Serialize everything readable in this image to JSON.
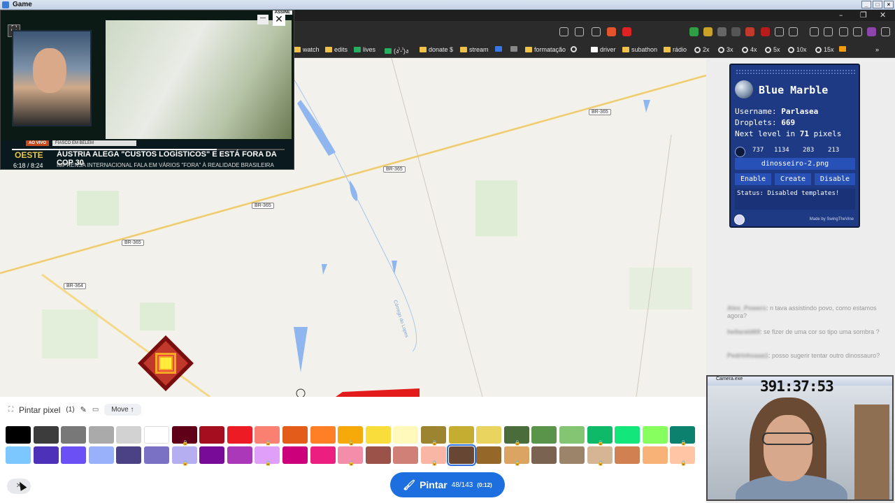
{
  "window": {
    "title": "Game"
  },
  "bookmarks": [
    "watch",
    "edits",
    "lives",
    "(ง'̀-'́)ง",
    "donate $",
    "stream",
    "formatação",
    "driver",
    "subathon",
    "rádio",
    "2x",
    "3x",
    "4x",
    "5x",
    "10x",
    "15x"
  ],
  "map": {
    "road_labels": [
      "BR-365",
      "BR-365",
      "BR-365",
      "BR-365",
      "BR-364"
    ],
    "stream_label": "Córrego do Lopes"
  },
  "pip": {
    "live_badge": "AO VIVO",
    "subtitle": "FIASCO EM BELÉM",
    "headline": "ÁUSTRIA ALEGA \"CUSTOS LOGÍSTICOS\" E ESTÁ FORA DA COP 30",
    "subline": "IMPRENSA INTERNACIONAL FALA EM VÁRIOS \"FORA\" À REALIDADE BRASILEIRA",
    "time": "6:18 / 8:24",
    "channel": "OESTE",
    "assine": "ASSINE",
    "progress": 0.75
  },
  "blue_marble": {
    "title": "Blue Marble",
    "username_label": "Username:",
    "username": "Parlasea",
    "droplets_label": "Droplets:",
    "droplets": "669",
    "next_level_prefix": "Next level in",
    "next_level_value": "71",
    "next_level_suffix": "pixels",
    "coords": [
      "737",
      "1134",
      "283",
      "213"
    ],
    "file": "dinosseiro-2.png",
    "buttons": {
      "enable": "Enable",
      "create": "Create",
      "disable": "Disable"
    },
    "status": "Status: Disabled templates!",
    "made_by": "Made by SwingTheVine"
  },
  "chat": [
    {
      "user": "Alex_Powers",
      "text": ": n tava assistindo povo, como estamos agora?"
    },
    {
      "user": "hellarald69",
      "text": ": se fizer de uma cor so tipo uma sombra ?"
    },
    {
      "user": "Pedrinhoaaa1",
      "text": ": posso sugerir tentar outro dinossauro?"
    }
  ],
  "camera": {
    "title": "Camera.exe",
    "timer": "391:37:53"
  },
  "paint": {
    "header": "Pintar pixel",
    "count": "(1)",
    "move": "Move",
    "button_label": "Pintar",
    "button_count": "48/143",
    "button_time": "(0:12)",
    "palette_row1": [
      "#000000",
      "#3c3c3c",
      "#787878",
      "#aaaaaa",
      "#d2d2d2",
      "#ffffff",
      "#600018",
      "#a50e1e",
      "#ed1c24",
      "#fa8072",
      "#e45c1a",
      "#ff7f27",
      "#f6aa09",
      "#f9dd3b",
      "#fffabc",
      "#9c8431",
      "#c5ad31",
      "#e8d45f",
      "#4a6b3a",
      "#5a944a",
      "#84c573",
      "#0eb968",
      "#13e67b",
      "#87ff5e",
      "#0c816e"
    ],
    "palette_row2": [
      "#7dc7ff",
      "#4d31b8",
      "#6b50f6",
      "#99b1fb",
      "#4a4284",
      "#7a71c4",
      "#b5aef1",
      "#780c99",
      "#aa38b9",
      "#e09ff9",
      "#cb007a",
      "#ec1f80",
      "#f38da9",
      "#9b5249",
      "#d18078",
      "#fab6a4",
      "#684634",
      "#95682a",
      "#dba463",
      "#7b6352",
      "#9c846b",
      "#d6b594",
      "#d18051",
      "#f8b277",
      "#ffc5a5"
    ],
    "selected_index_row2": 16
  }
}
